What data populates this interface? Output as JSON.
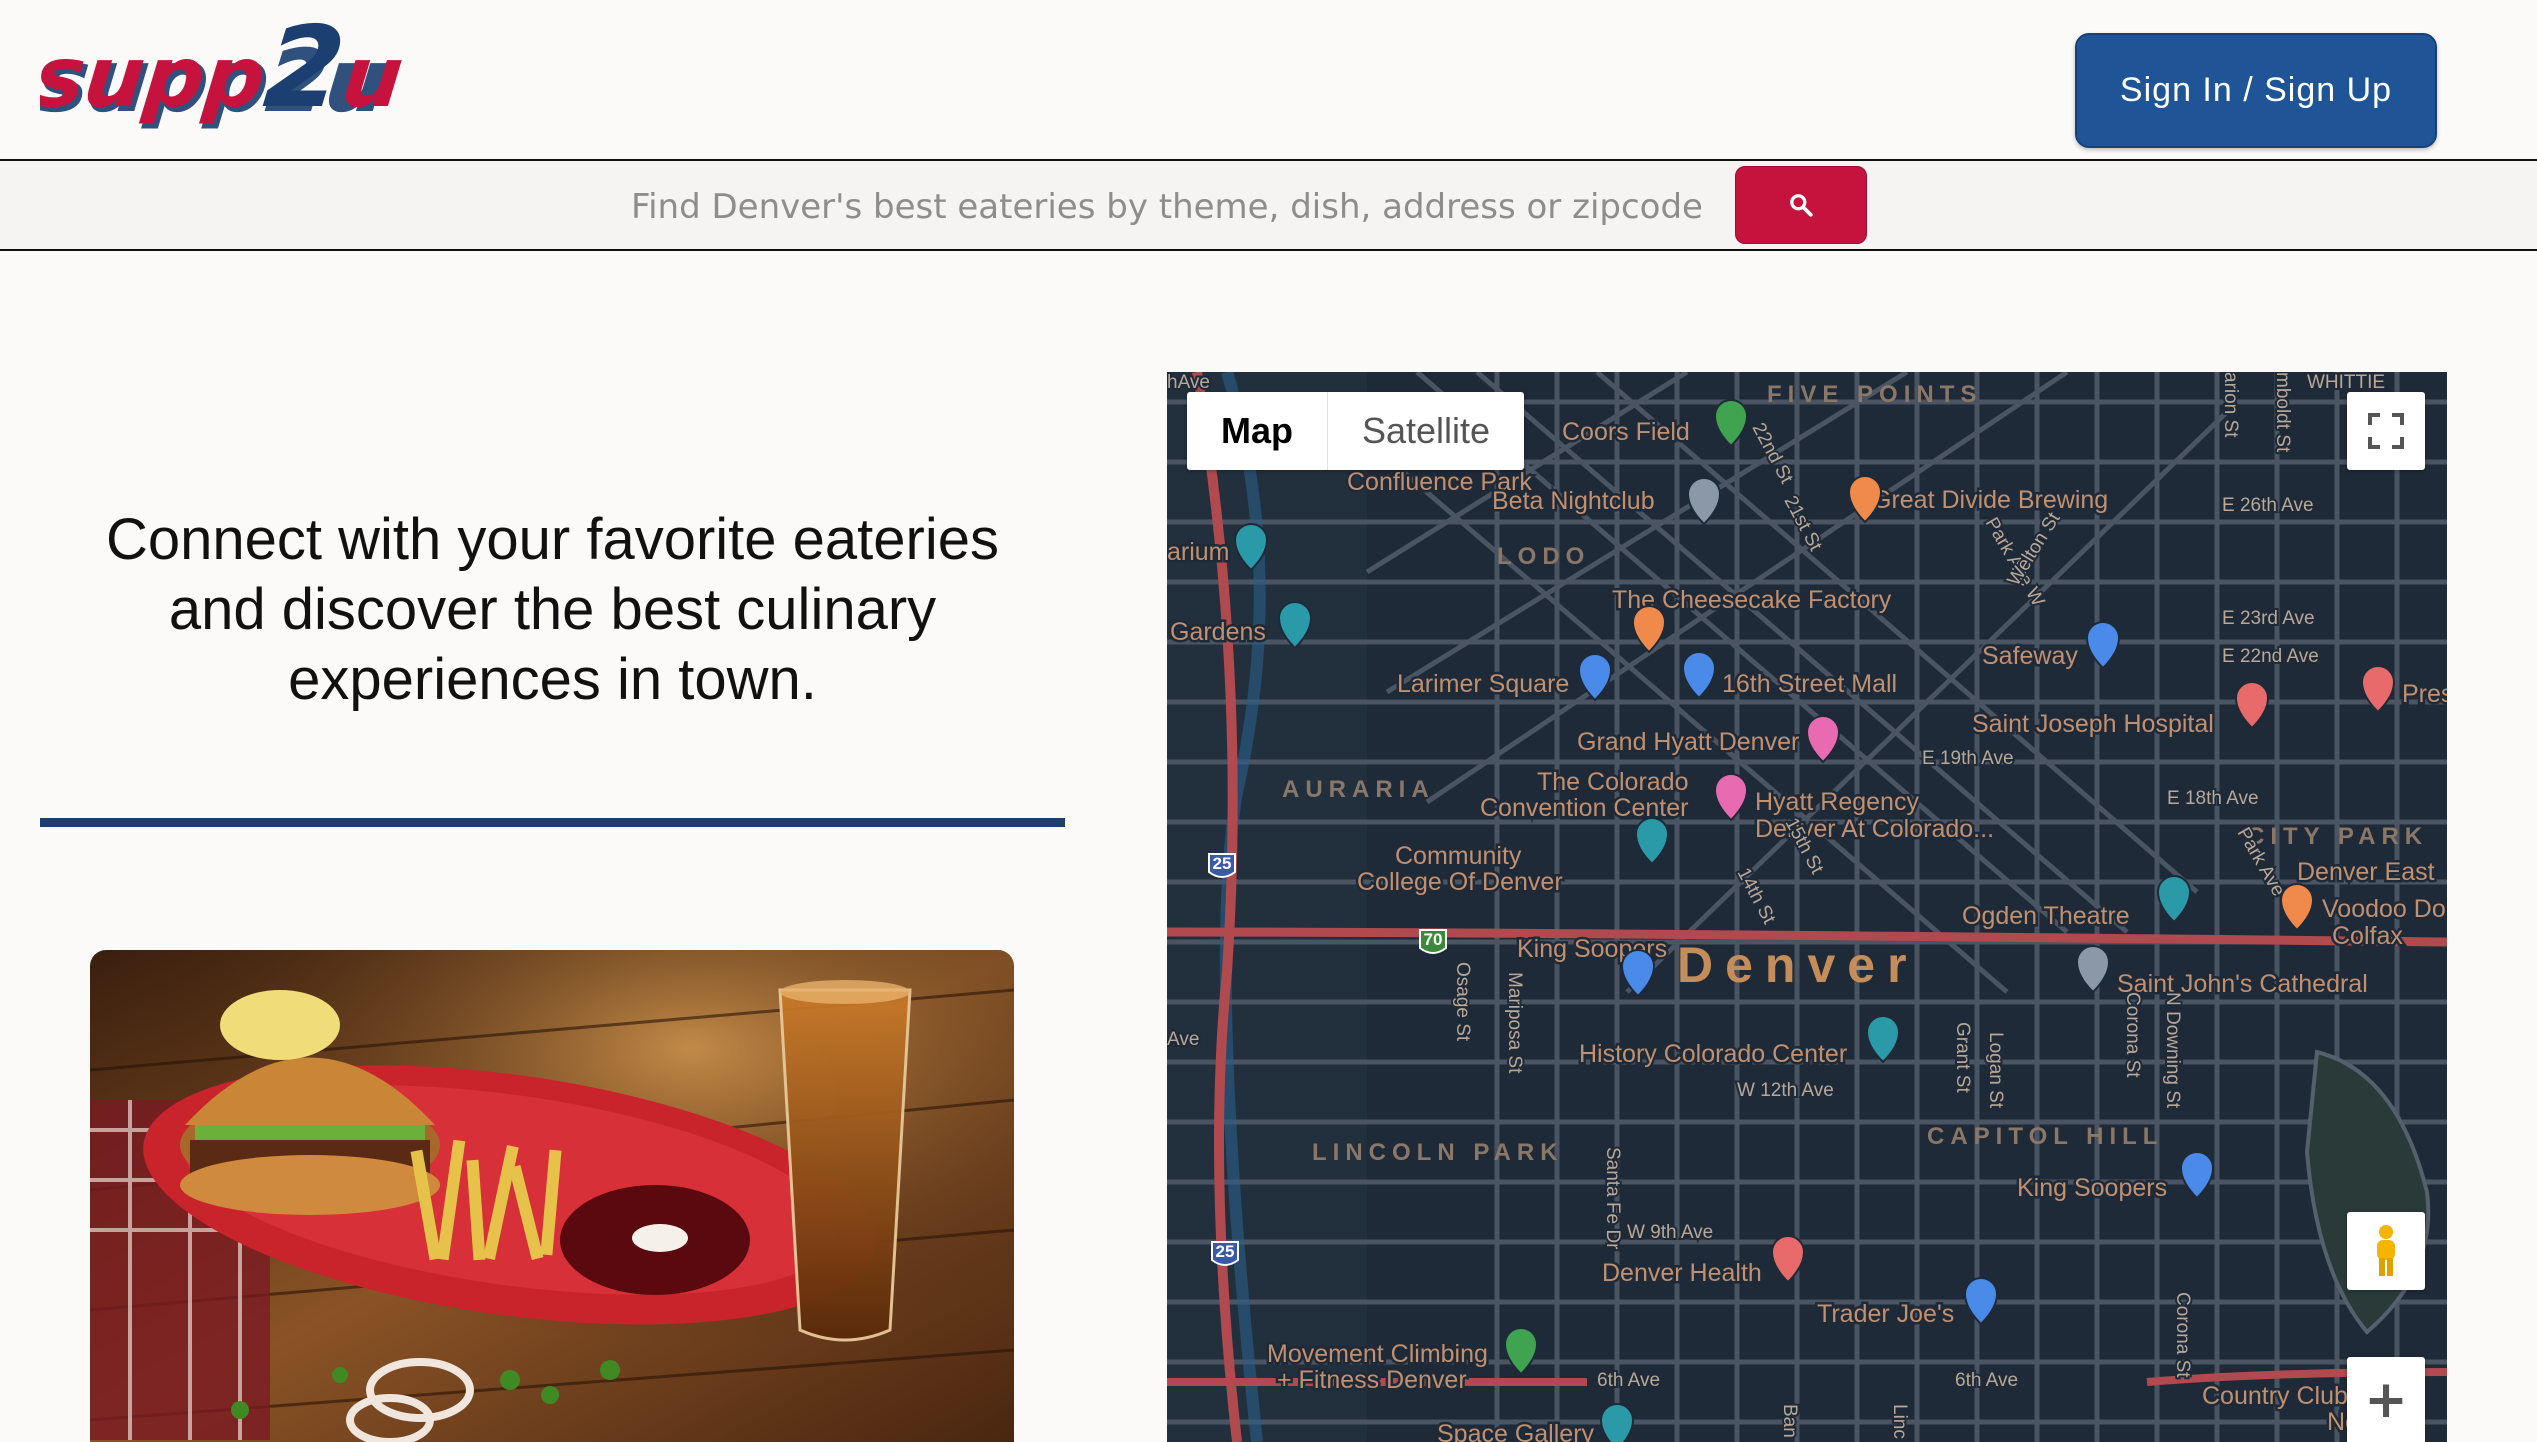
{
  "brand": {
    "logo_text": "supp2u",
    "logo_colors": {
      "primary": "#c5133e",
      "secondary": "#1a3f70"
    }
  },
  "header": {
    "signin_label": "Sign In / Sign Up"
  },
  "search": {
    "placeholder": "Find Denver's best eateries by theme, dish, address or zipcode",
    "icon": "search-icon"
  },
  "hero": {
    "lines": [
      "Connect with your favorite eateries",
      "and discover the best culinary",
      "experiences in town."
    ]
  },
  "colors": {
    "accent": "#c5133e",
    "button_blue": "#1f5596",
    "divider": "#1a3f70",
    "map_bg": "#1f2a38"
  },
  "map": {
    "type_buttons": [
      "Map",
      "Satellite"
    ],
    "active_type": "Map",
    "city_label": "Denver",
    "districts": [
      "FIVE POINTS",
      "LODO",
      "AURARIA",
      "CITY PARK",
      "CAPITOL HILL",
      "LINCOLN PARK"
    ],
    "places": [
      "Coors Field",
      "Confluence Park",
      "Beta Nightclub",
      "Great Divide Brewing",
      "arium",
      "Gardens",
      "The Cheesecake Factory",
      "Larimer Square",
      "16th Street Mall",
      "Safeway",
      "Saint Joseph Hospital",
      "Pres Luke",
      "Grand Hyatt Denver",
      "The Colorado",
      "Convention Center",
      "Hyatt Regency",
      "Denver At Colorado...",
      "Community",
      "College Of Denver",
      "Denver East",
      "Ogden Theatre",
      "Voodoo Do",
      "Colfax",
      "King Soopers",
      "Saint John's Cathedral",
      "History Colorado Center",
      "King Soopers",
      "Denver Health",
      "Trader Joe's",
      "Movement Climbing",
      "+ Fitness Denver",
      "Space Gallery",
      "Country Club",
      "Neigh"
    ],
    "streets": [
      "E 26th Ave",
      "E 23rd Ave",
      "E 22nd Ave",
      "E 19th Ave",
      "E 18th Ave",
      "W 12th Ave",
      "W 9th Ave",
      "6th Ave",
      "6th Ave",
      "22nd St",
      "21st St",
      "Park Ave W",
      "Welton St",
      "14th St",
      "15th St",
      "Osage St",
      "Mariposa St",
      "Santa Fe Dr",
      "Grant St",
      "Logan St",
      "Corona St",
      "N Downing St",
      "Corona St",
      "Park Ave",
      "arion St",
      "mboldt St",
      "WHITTIE",
      "hAve",
      "Ave",
      "Ban",
      "Linc"
    ],
    "highway_shields": [
      "25",
      "70",
      "25"
    ],
    "controls": {
      "fullscreen": "fullscreen-icon",
      "streetview": "pegman-icon",
      "zoom_in": "+"
    }
  }
}
